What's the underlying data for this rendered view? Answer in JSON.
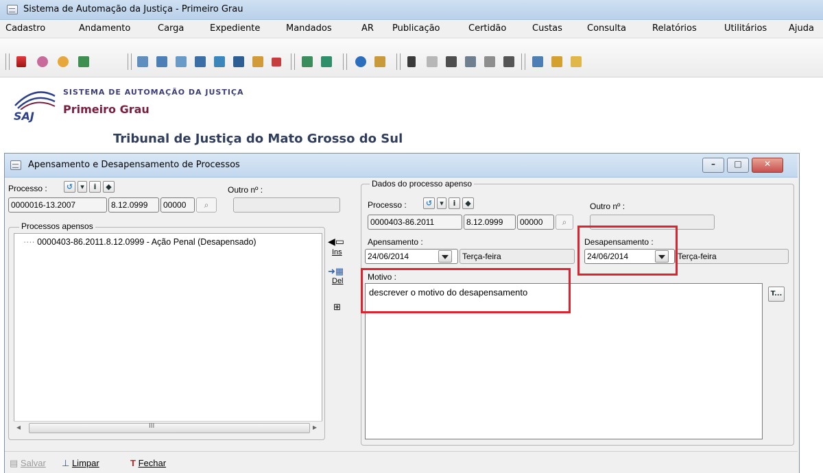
{
  "window": {
    "title": "Sistema de Automação da Justiça - Primeiro Grau"
  },
  "menu": {
    "items": [
      "Cadastro",
      "Andamento",
      "Carga",
      "Expediente",
      "Mandados",
      "AR",
      "Publicação",
      "Certidão",
      "Custas",
      "Consulta",
      "Relatórios",
      "Utilitários",
      "Ajuda"
    ]
  },
  "logo": {
    "system_name": "SISTEMA DE AUTOMAÇÃO DA JUSTIÇA",
    "product": "Primeiro Grau",
    "saj": "SAJ",
    "tribunal": "Tribunal de Justiça do Mato Grosso do Sul"
  },
  "dialog": {
    "title": "Apensamento e Desapensamento de Processos",
    "left": {
      "processo_label": "Processo :",
      "outro_label": "Outro nº :",
      "processo_parts": [
        "0000016-13.2007",
        "8.12.0999",
        "00000"
      ],
      "outro_value": "",
      "apensos_label": "Processos apensos",
      "apensos_items": [
        "0000403-86.2011.8.12.0999 - Ação Penal (Desapensado)"
      ],
      "ins_label": "Ins",
      "del_label": "Del",
      "scroll_thumb": "III"
    },
    "right": {
      "group_label": "Dados do processo apenso",
      "processo_label": "Processo :",
      "outro_label": "Outro nº :",
      "processo_parts": [
        "0000403-86.2011",
        "8.12.0999",
        "00000"
      ],
      "outro_value": "",
      "apensamento_label": "Apensamento :",
      "apensamento_date": "24/06/2014",
      "apensamento_weekday": "Terça-feira",
      "desapensamento_label": "Desapensamento :",
      "desapensamento_date": "24/06/2014",
      "desapensamento_weekday": "Terça-feira",
      "motivo_label": "Motivo :",
      "motivo_text": "descrever o motivo do desapensamento",
      "text_button": "T..."
    },
    "footer": {
      "salvar": "Salvar",
      "limpar": "Limpar",
      "fechar": "Fechar"
    }
  },
  "colors": {
    "highlight": "#e0222e",
    "titlebar": "#c2d7ee",
    "logo_accent": "#7a1d3c"
  }
}
